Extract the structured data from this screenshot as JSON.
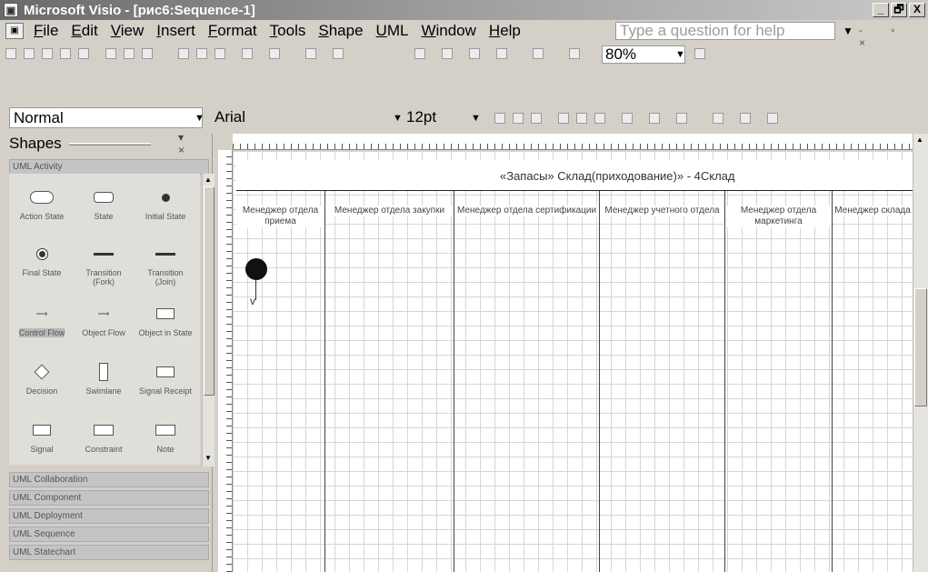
{
  "window": {
    "title": "Microsoft Visio - [рис6:Sequence-1]",
    "controls": [
      "_",
      "🗗",
      "X"
    ]
  },
  "menu": {
    "items": [
      "File",
      "Edit",
      "View",
      "Insert",
      "Format",
      "Tools",
      "Shape",
      "UML",
      "Window",
      "Help"
    ],
    "help_placeholder": "Type a question for help"
  },
  "toolbar": {
    "zoom": "80%",
    "style": "Normal",
    "font": "Arial",
    "size": "12pt"
  },
  "shapes": {
    "title": "Shapes",
    "active_stencil": "UML Activity",
    "items": [
      {
        "label": "Action State",
        "icon": "action-state-icon"
      },
      {
        "label": "State",
        "icon": "state-icon"
      },
      {
        "label": "Initial State",
        "icon": "initial-state-icon"
      },
      {
        "label": "Final State",
        "icon": "final-state-icon"
      },
      {
        "label": "Transition (Fork)",
        "icon": "fork-icon"
      },
      {
        "label": "Transition (Join)",
        "icon": "join-icon"
      },
      {
        "label": "Control Flow",
        "icon": "control-flow-icon"
      },
      {
        "label": "Object Flow",
        "icon": "object-flow-icon"
      },
      {
        "label": "Object in State",
        "icon": "object-in-state-icon"
      },
      {
        "label": "Decision",
        "icon": "decision-icon"
      },
      {
        "label": "Swimlane",
        "icon": "swimlane-icon"
      },
      {
        "label": "Signal Receipt",
        "icon": "signal-receipt-icon"
      },
      {
        "label": "Signal",
        "icon": "signal-icon"
      },
      {
        "label": "Constraint",
        "icon": "constraint-icon"
      },
      {
        "label": "Note",
        "icon": "note-icon"
      }
    ],
    "stencils": [
      "UML Collaboration",
      "UML Component",
      "UML Deployment",
      "UML Sequence",
      "UML Statechart"
    ]
  },
  "diagram": {
    "title": "«Запасы» Склад(приходование)» - 4Склад",
    "lanes": [
      "Менеджер отдела приема",
      "Менеджер отдела закупки",
      "Менеджер отдела сертификации",
      "Менеджер учетного отдела",
      "Менеджер отдела маркетинга",
      "Менеджер склада"
    ]
  }
}
